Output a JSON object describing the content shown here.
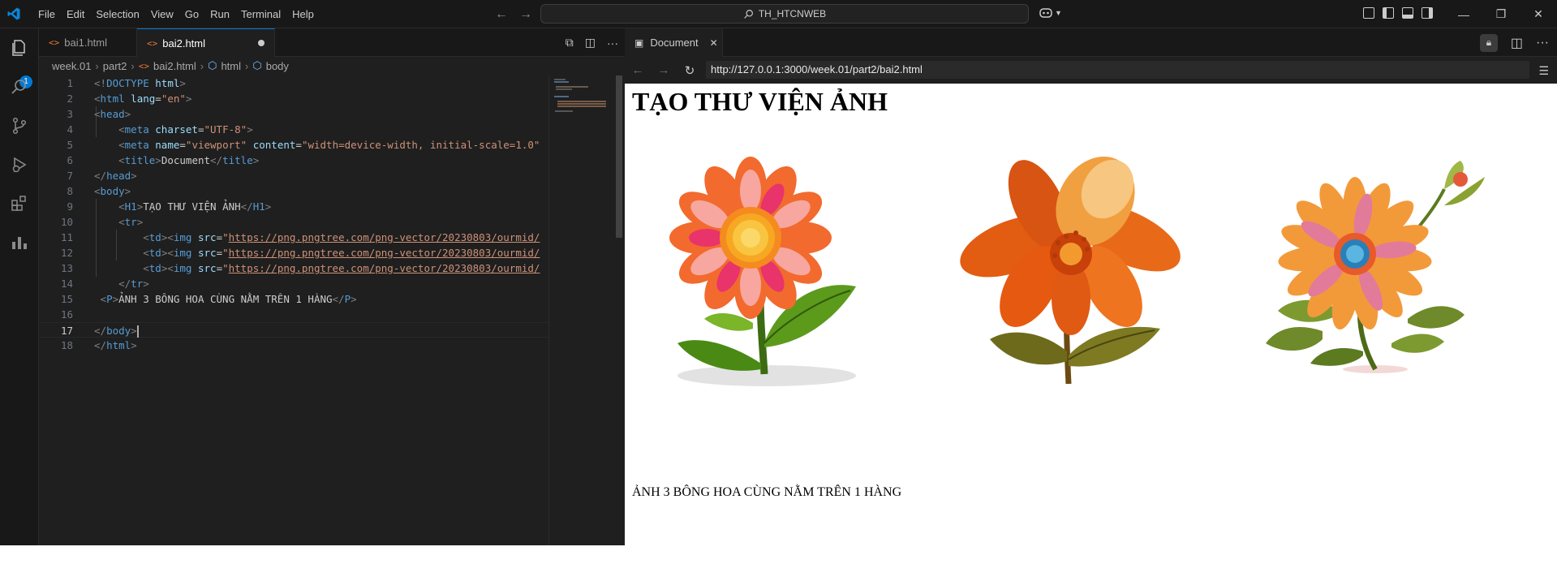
{
  "titlebar": {
    "menu": [
      "File",
      "Edit",
      "Selection",
      "View",
      "Go",
      "Run",
      "Terminal",
      "Help"
    ],
    "search_text": "TH_HTCNWEB"
  },
  "activitybar": {
    "explorer_badge": "1"
  },
  "editor": {
    "tabs": [
      {
        "label": "bai1.html",
        "active": false
      },
      {
        "label": "bai2.html",
        "active": true,
        "modified": true
      }
    ],
    "breadcrumb": [
      "week.01",
      "part2",
      "bai2.html",
      "html",
      "body"
    ],
    "active_line": 17,
    "line_numbers": [
      "1",
      "2",
      "3",
      "4",
      "5",
      "6",
      "7",
      "8",
      "9",
      "10",
      "11",
      "12",
      "13",
      "14",
      "15",
      "16",
      "17",
      "18"
    ]
  },
  "preview": {
    "tab_label": "Document",
    "url": "http://127.0.0.1:3000/week.01/part2/bai2.html",
    "heading": "TẠO THƯ VIỆN ẢNH",
    "caption": "ẢNH 3 BÔNG HOA CÙNG NẰM TRÊN 1 HÀNG"
  },
  "colors": {
    "accent": "#0078d4",
    "tag": "#569cd6",
    "attr": "#9cdcfe",
    "string": "#ce9178"
  }
}
